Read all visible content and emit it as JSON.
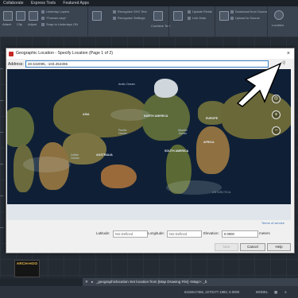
{
  "menu": [
    "Collaborate",
    "Express Tools",
    "Featured Apps"
  ],
  "ribbon": {
    "left_col": [
      "Attach",
      "Clip",
      "Adjust"
    ],
    "mid_col": [
      "Underlay Layers",
      "*Frames vary*",
      "Snap to Underlays ON"
    ],
    "import_group": [
      "Recognize SHX Text",
      "Recognize Settings",
      "Combine Text"
    ],
    "data_group": [
      "Extract Data",
      "Update Fields",
      "Link Data"
    ],
    "linking_group": [
      "Download from Source",
      "Upload to Source",
      "Data Extraction"
    ],
    "location_btn": "Location",
    "panels": [
      "Reference",
      "Import",
      "Data",
      "Linking & Extraction",
      "Location"
    ]
  },
  "dialog": {
    "title": "Geographic Location - Specify Location (Page 1 of 2)",
    "close": "×",
    "address_label": "Address:",
    "address_value": "20.532095, -103.454365",
    "search_icon": "search-icon",
    "terms": "Terms of service",
    "copyright": "© 2020 Microsoft Corporation",
    "terms_small": "Terms",
    "scale": [
      "2000 miles",
      "5000 km"
    ],
    "latitude_label": "Latitude:",
    "latitude_value": "Not Defined",
    "longitude_label": "Longitude:",
    "longitude_value": "Not Defined",
    "elevation_label": "Elevation:",
    "elevation_value": "0.0000",
    "elevation_unit": "meters",
    "buttons": {
      "next": "Next",
      "cancel": "Cancel",
      "help": "Help"
    }
  },
  "map_labels": {
    "arctic": "Arctic\nOcean",
    "asia": "ASIA",
    "north_america": "NORTH AMERICA",
    "europe": "EUROPE",
    "pacific": "Pacific\nOcean",
    "atlantic": "Atlantic\nOcean",
    "africa": "AFRICA",
    "south_america": "SOUTH AMERICA",
    "indian": "Indian\nOcean",
    "australia": "AUSTRALIA",
    "antarctica": "ANTARCTICA"
  },
  "command_line": "_geographiclocation Set location from [Map Drawing File] <Map>: _b",
  "status": {
    "coords": "6415517456, 2270177.1983, 0.0000",
    "model": "MODEL"
  },
  "logo": "ARCH-HOO"
}
